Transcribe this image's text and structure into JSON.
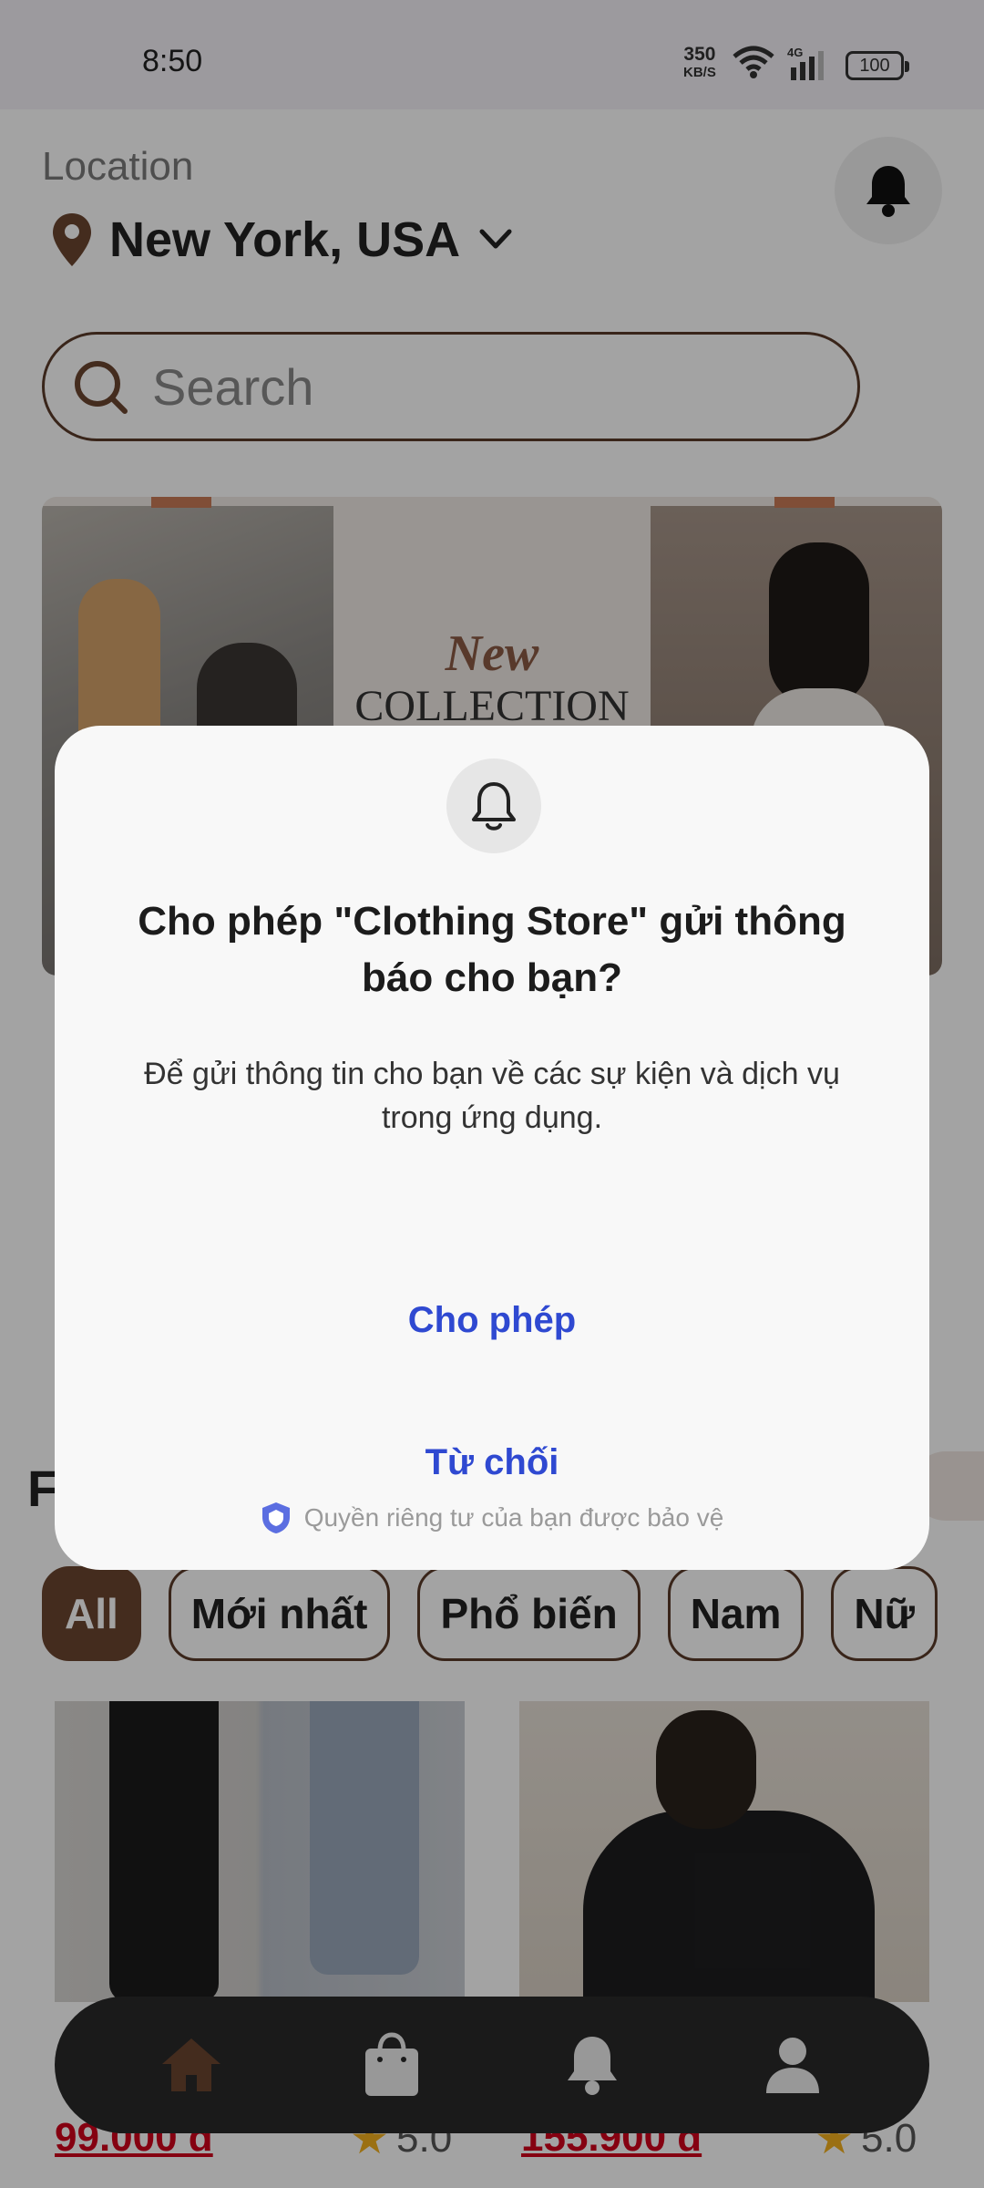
{
  "status_bar": {
    "time": "8:50",
    "net_speed_value": "350",
    "net_speed_unit": "KB/S",
    "battery": "100",
    "cell_label": "4G"
  },
  "header": {
    "location_label": "Location",
    "location_value": "New York, USA"
  },
  "search": {
    "placeholder": "Search"
  },
  "banner": {
    "line1": "New",
    "line2": "COLLECTION"
  },
  "section": {
    "title_partial": "F"
  },
  "filters": [
    "All",
    "Mới nhất",
    "Phổ biến",
    "Nam",
    "Nữ"
  ],
  "products": [
    {
      "price": "99.000 đ",
      "rating": "5.0"
    },
    {
      "price": "155.900 đ",
      "rating": "5.0"
    }
  ],
  "dialog": {
    "title": "Cho phép \"Clothing Store\" gửi thông báo cho bạn?",
    "body": "Để gửi thông tin cho bạn về các sự kiện và dịch vụ trong ứng dụng.",
    "allow_label": "Cho phép",
    "deny_label": "Từ chối",
    "privacy_note": "Quyền riêng tư của bạn được bảo vệ"
  },
  "colors": {
    "brand_brown": "#6b4530",
    "dialog_button_blue": "#2f49d1",
    "price_red": "#d0021b",
    "nav_background": "#2a2a2a"
  },
  "icons": [
    "location-pin-icon",
    "chevron-down-icon",
    "bell-icon",
    "search-icon",
    "home-icon",
    "bag-icon",
    "notification-icon",
    "profile-icon",
    "star-icon",
    "shield-icon"
  ]
}
